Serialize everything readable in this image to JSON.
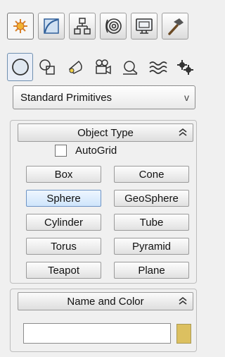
{
  "command_panel": {
    "tabs": [
      {
        "icon": "create-sunburst-icon",
        "active": true
      },
      {
        "icon": "modify-curve-icon",
        "active": false
      },
      {
        "icon": "hierarchy-icon",
        "active": false
      },
      {
        "icon": "motion-icon",
        "active": false
      },
      {
        "icon": "display-monitor-icon",
        "active": false
      },
      {
        "icon": "utilities-hammer-icon",
        "active": false
      }
    ],
    "create_categories": [
      {
        "icon": "geometry-sphere-icon",
        "active": true
      },
      {
        "icon": "shapes-icon",
        "active": false
      },
      {
        "icon": "lights-icon",
        "active": false
      },
      {
        "icon": "cameras-icon",
        "active": false
      },
      {
        "icon": "helpers-icon",
        "active": false
      },
      {
        "icon": "space-warps-icon",
        "active": false
      },
      {
        "icon": "systems-icon",
        "active": false
      }
    ],
    "subcategory": {
      "selected": "Standard Primitives",
      "arrow": "v"
    }
  },
  "object_type": {
    "title": "Object Type",
    "collapse_symbol": "⌃",
    "autogrid": {
      "label": "AutoGrid",
      "checked": false
    },
    "buttons": [
      {
        "label": "Box"
      },
      {
        "label": "Cone"
      },
      {
        "label": "Sphere",
        "active": true
      },
      {
        "label": "GeoSphere"
      },
      {
        "label": "Cylinder"
      },
      {
        "label": "Tube"
      },
      {
        "label": "Torus"
      },
      {
        "label": "Pyramid"
      },
      {
        "label": "Teapot"
      },
      {
        "label": "Plane"
      }
    ]
  },
  "name_and_color": {
    "title": "Name and Color",
    "name_value": "",
    "color": "#dcc060"
  }
}
